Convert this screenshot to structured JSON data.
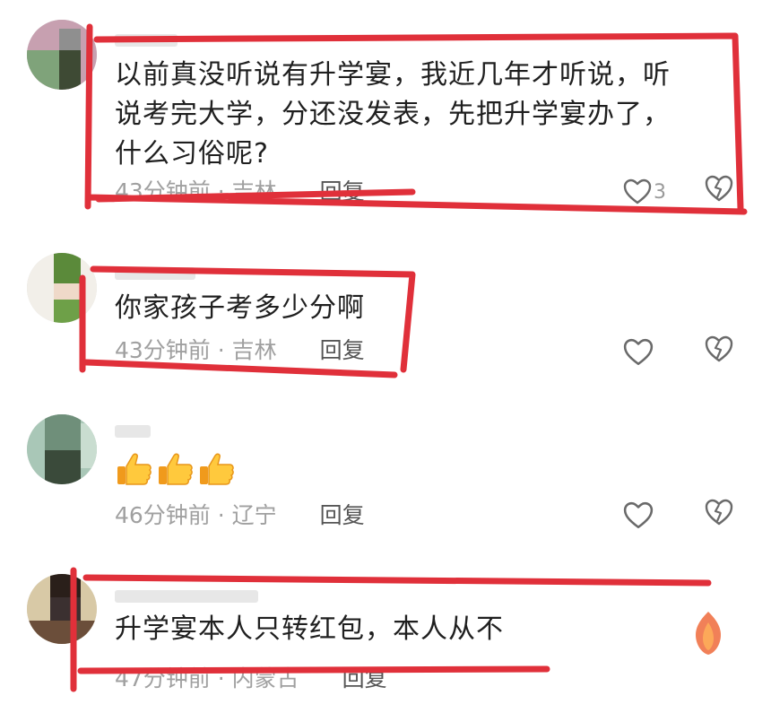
{
  "comments": [
    {
      "content_lines": [
        "以前真没听说有升学宴，我近几年才听说，听",
        "说考完大学，分还没发表，先把升学宴办了，",
        "什么习俗呢?"
      ],
      "time": "43分钟前",
      "location": "吉林",
      "reply_label": "回复",
      "like_count": "3"
    },
    {
      "content": "你家孩子考多少分啊",
      "time": "43分钟前",
      "location": "吉林",
      "reply_label": "回复"
    },
    {
      "time": "46分钟前",
      "location": "辽宁",
      "reply_label": "回复"
    },
    {
      "content": "升学宴本人只转红包，本人从不",
      "time": "47分钟前",
      "location": "内蒙古",
      "reply_label": "回复"
    }
  ],
  "separator": "·",
  "icons": {
    "like": "heart-outline-icon",
    "dislike": "broken-heart-icon",
    "emoji": "thumbs-up-emoji",
    "emoji_count": 3
  },
  "colors": {
    "annotation": "#e0303a",
    "meta": "#a0a0a0",
    "text": "#1f1f1f"
  }
}
